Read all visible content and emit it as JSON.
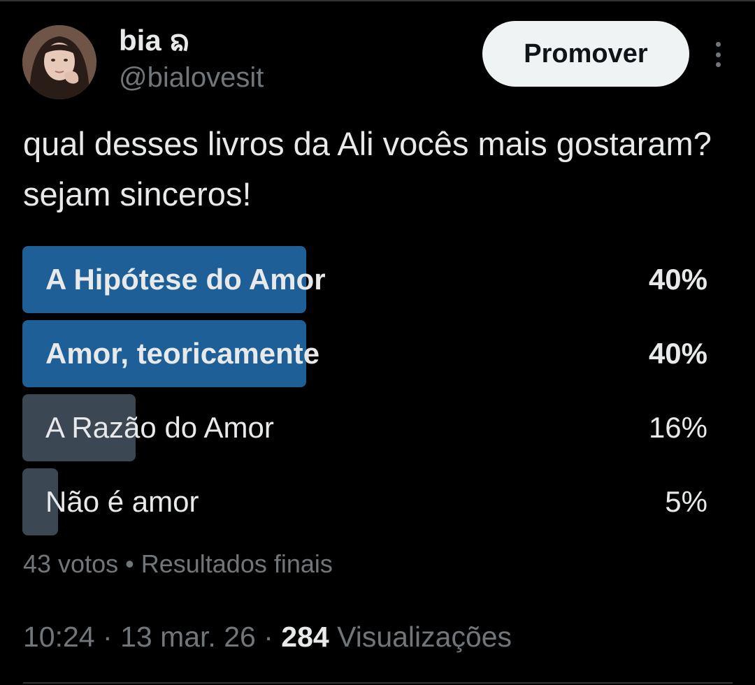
{
  "header": {
    "display_name": "bia ᨦ",
    "handle": "@bialovesit",
    "promote_label": "Promover"
  },
  "tweet": {
    "text": "qual desses livros da Ali vocês mais gostaram? sejam sinceros!"
  },
  "poll": {
    "options": [
      {
        "label": "A Hipótese do Amor",
        "percent_text": "40%",
        "percent": 40,
        "winner": true
      },
      {
        "label": "Amor, teoricamente",
        "percent_text": "40%",
        "percent": 40,
        "winner": true
      },
      {
        "label": "A Razão do Amor",
        "percent_text": "16%",
        "percent": 16,
        "winner": false
      },
      {
        "label": "Não é amor",
        "percent_text": "5%",
        "percent": 5,
        "winner": false
      }
    ],
    "votes": "43 votos",
    "separator": "•",
    "status": "Resultados finais"
  },
  "meta": {
    "time": "10:24",
    "dot": "·",
    "date": "13 mar. 26",
    "views_count": "284",
    "views_label": "Visualizações"
  },
  "colors": {
    "background": "#000000",
    "winner_bar": "#1d5f96",
    "loser_bar": "#3b4753",
    "muted_text": "#71767b",
    "primary_text": "#e7e9ea"
  },
  "icons": {
    "more": "more-options-icon"
  }
}
